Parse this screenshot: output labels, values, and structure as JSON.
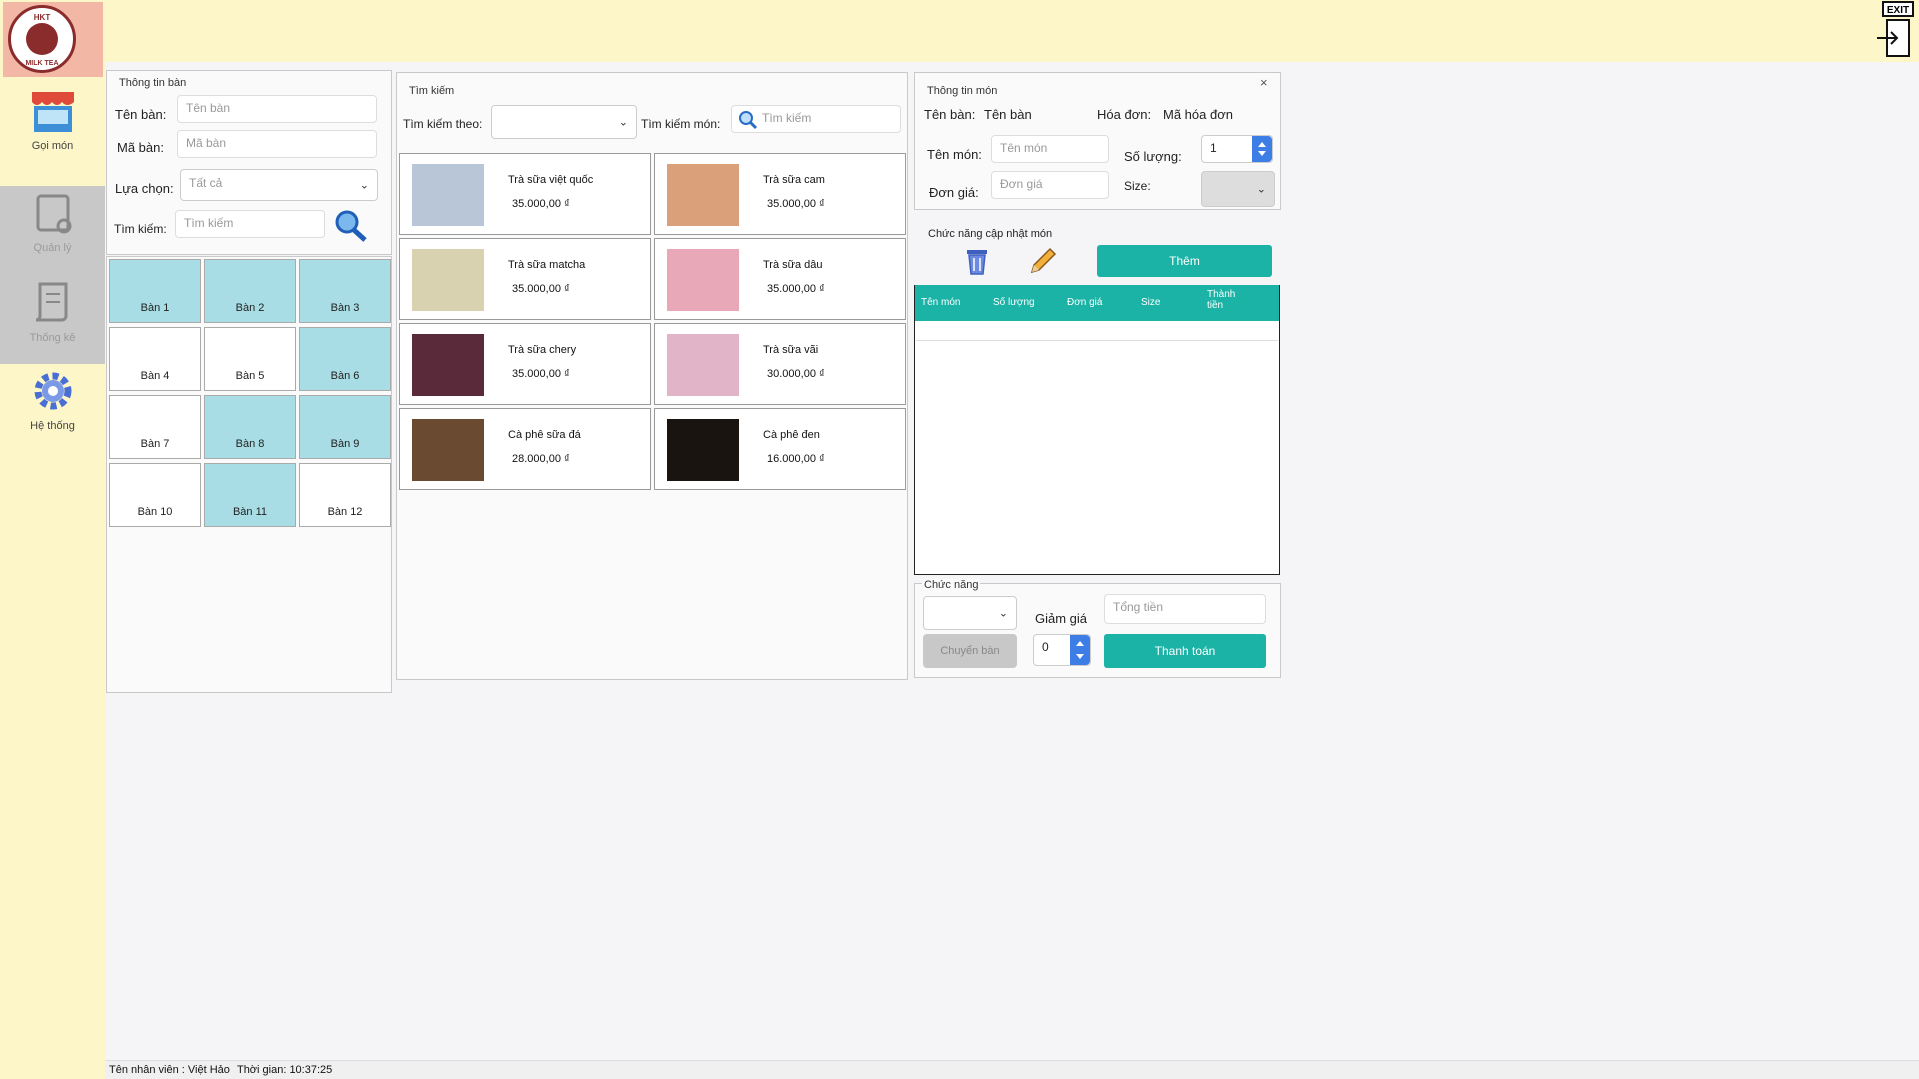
{
  "logo": {
    "top_text": "HKT",
    "bottom_text": "MILK TEA"
  },
  "sidebar": {
    "items": [
      {
        "label": "Gọi món",
        "icon": "store-icon"
      },
      {
        "label": "Quản lý",
        "icon": "document-icon"
      },
      {
        "label": "Thống kê",
        "icon": "scroll-icon"
      },
      {
        "label": "Hệ thống",
        "icon": "gear-icon"
      }
    ]
  },
  "exit_label": "EXIT",
  "table_info": {
    "title": "Thông tin bàn",
    "name_label": "Tên bàn:",
    "name_placeholder": "Tên bàn",
    "id_label": "Mã bàn:",
    "id_placeholder": "Mã bàn",
    "filter_label": "Lựa chọn:",
    "filter_value": "Tất cả",
    "search_label": "Tìm kiếm:",
    "search_placeholder": "Tìm kiếm"
  },
  "tables": [
    {
      "name": "Bàn 1",
      "occupied": true
    },
    {
      "name": "Bàn 2",
      "occupied": true
    },
    {
      "name": "Bàn 3",
      "occupied": true
    },
    {
      "name": "Bàn 4",
      "occupied": false
    },
    {
      "name": "Bàn 5",
      "occupied": false
    },
    {
      "name": "Bàn 6",
      "occupied": true
    },
    {
      "name": "Bàn 7",
      "occupied": false
    },
    {
      "name": "Bàn 8",
      "occupied": true
    },
    {
      "name": "Bàn 9",
      "occupied": true
    },
    {
      "name": "Bàn 10",
      "occupied": false
    },
    {
      "name": "Bàn 11",
      "occupied": true
    },
    {
      "name": "Bàn 12",
      "occupied": false
    }
  ],
  "search": {
    "title": "Tìm kiếm",
    "by_label": "Tìm kiếm theo:",
    "by_value": "",
    "dish_label": "Tìm kiếm món:",
    "dish_placeholder": "Tìm kiếm"
  },
  "menu_items": [
    {
      "name": "Trà sữa việt quốc",
      "price": "35.000,00 ₫",
      "img_color": "#b9c6d8"
    },
    {
      "name": "Trà sữa cam",
      "price": "35.000,00 ₫",
      "img_color": "#d9a07a"
    },
    {
      "name": "Trà sữa matcha",
      "price": "35.000,00 ₫",
      "img_color": "#d8d2b0"
    },
    {
      "name": "Trà sữa dâu",
      "price": "35.000,00 ₫",
      "img_color": "#e8a8b8"
    },
    {
      "name": "Trà sữa chery",
      "price": "35.000,00 ₫",
      "img_color": "#5a2a3a"
    },
    {
      "name": "Trà sữa vãi",
      "price": "30.000,00 ₫",
      "img_color": "#e2b4c8"
    },
    {
      "name": "Cà phê sữa đá",
      "price": "28.000,00 ₫",
      "img_color": "#6a4a30"
    },
    {
      "name": "Cà phê đen",
      "price": "16.000,00 ₫",
      "img_color": "#1a1410"
    }
  ],
  "dish_info": {
    "title": "Thông tin món",
    "table_label": "Tên bàn:",
    "table_value": "Tên bàn",
    "invoice_label": "Hóa đơn:",
    "invoice_value": "Mã hóa đơn",
    "dish_label": "Tên món:",
    "dish_placeholder": "Tên món",
    "qty_label": "Số lượng:",
    "qty_value": "1",
    "price_label": "Đơn giá:",
    "price_placeholder": "Đơn giá",
    "size_label": "Size:",
    "update_title": "Chức năng cập nhật món",
    "add_label": "Thêm"
  },
  "order_grid": {
    "columns": [
      "Tên món",
      "Số lượng",
      "Đơn giá",
      "Size",
      "Thành tiền"
    ],
    "rows": []
  },
  "functions": {
    "title": "Chức năng",
    "transfer_label": "Chuyển bàn",
    "discount_label": "Giảm giá",
    "discount_value": "0",
    "total_placeholder": "Tổng tiền",
    "pay_label": "Thanh toán"
  },
  "status": {
    "employee_label": "Tên nhân viên :",
    "employee_name": "Việt Hảo",
    "time_label": "Thời gian:",
    "time_value": "10:37:25"
  },
  "colors": {
    "accent": "#1ab3a6",
    "occupied": "#a9dde5",
    "topbar": "#fdf6c9"
  }
}
